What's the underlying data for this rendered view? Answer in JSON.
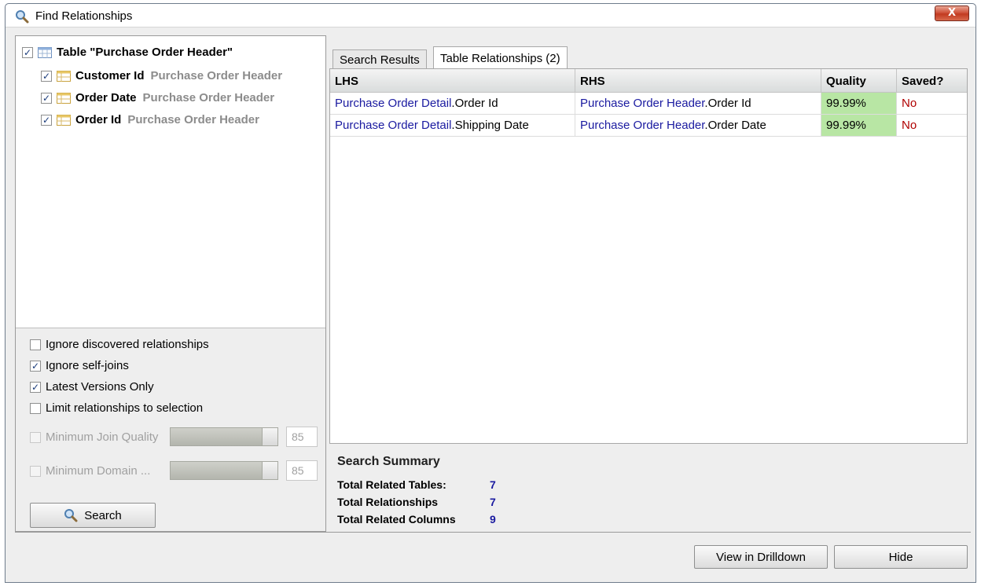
{
  "window": {
    "title": "Find Relationships",
    "close_label": "X"
  },
  "tree": {
    "root": {
      "label": "Table \"Purchase Order Header\"",
      "checked": true
    },
    "children": [
      {
        "name": "Customer Id",
        "table": "Purchase Order Header",
        "checked": true
      },
      {
        "name": "Order Date",
        "table": "Purchase Order Header",
        "checked": true
      },
      {
        "name": "Order Id",
        "table": "Purchase Order Header",
        "checked": true
      }
    ]
  },
  "options": [
    {
      "label": "Ignore discovered relationships",
      "checked": false
    },
    {
      "label": "Ignore self-joins",
      "checked": true
    },
    {
      "label": "Latest Versions Only",
      "checked": true
    },
    {
      "label": "Limit relationships to selection",
      "checked": false
    }
  ],
  "thresholds": [
    {
      "label": "Minimum Join Quality",
      "value": "85",
      "enabled": false
    },
    {
      "label": "Minimum Domain ...",
      "value": "85",
      "enabled": false
    }
  ],
  "search_button": "Search",
  "tabs": [
    {
      "label": "Search Results",
      "active": false
    },
    {
      "label": "Table Relationships (2)",
      "active": true
    }
  ],
  "table": {
    "columns": [
      "LHS",
      "RHS",
      "Quality",
      "Saved?"
    ],
    "rows": [
      {
        "lhs_table": "Purchase Order Detail",
        "lhs_col": ".Order Id",
        "rhs_table": "Purchase Order Header",
        "rhs_col": ".Order Id",
        "quality": "99.99%",
        "saved": "No"
      },
      {
        "lhs_table": "Purchase Order Detail",
        "lhs_col": ".Shipping Date",
        "rhs_table": "Purchase Order Header",
        "rhs_col": ".Order Date",
        "quality": "99.99%",
        "saved": "No"
      }
    ]
  },
  "summary": {
    "title": "Search Summary",
    "items": [
      {
        "label": "Total Related Tables:",
        "value": "7"
      },
      {
        "label": "Total Relationships",
        "value": "7"
      },
      {
        "label": "Total Related Columns",
        "value": "9"
      }
    ]
  },
  "buttons": {
    "drilldown": "View in Drilldown",
    "hide": "Hide"
  },
  "colors": {
    "link": "#1a1aa0",
    "quality_bg": "#b8e6a4",
    "saved_no": "#b00000",
    "close": "#c23a20"
  }
}
